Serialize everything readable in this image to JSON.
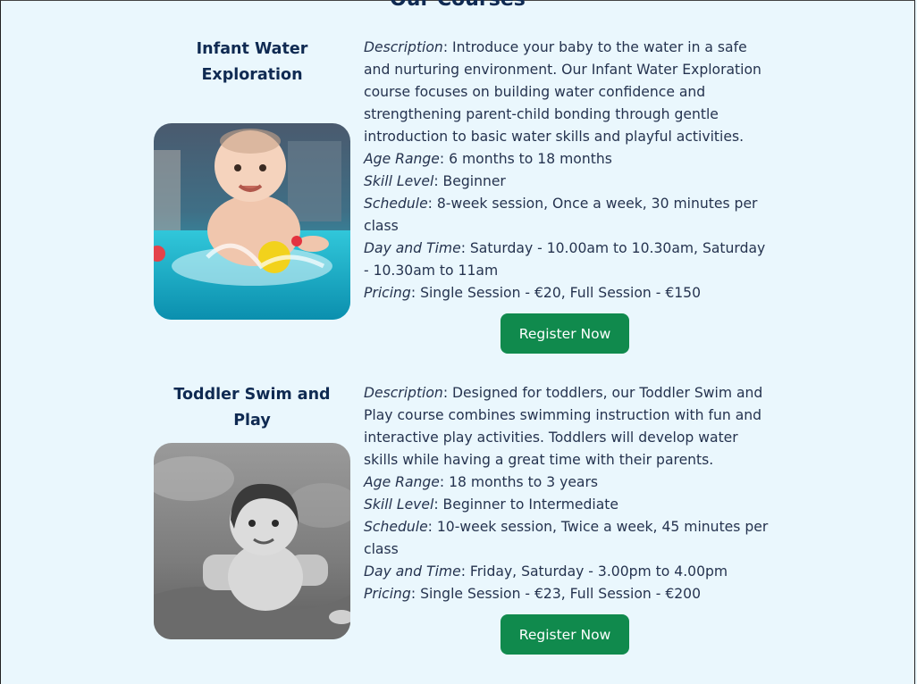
{
  "section": {
    "title": "Our Courses"
  },
  "courses": [
    {
      "title": "Infant Water Exploration",
      "description_label": "Description",
      "description": "Introduce your baby to the water in a safe and nurturing environment. Our Infant Water Exploration course focuses on building water confidence and strengthening parent-child bonding through gentle introduction to basic water skills and playful activities.",
      "age_label": "Age Range",
      "age": "6 months to 18 months",
      "skill_label": "Skill Level",
      "skill": "Beginner",
      "schedule_label": "Schedule",
      "schedule": "8-week session, Once a week, 30 minutes per class",
      "day_label": "Day and Time",
      "day": "Saturday - 10.00am to 10.30am, Saturday - 10.30am to 11am",
      "pricing_label": "Pricing",
      "pricing": "Single Session - €20, Full Session - €150",
      "register_label": "Register Now"
    },
    {
      "title": "Toddler Swim and Play",
      "description_label": "Description",
      "description": "Designed for toddlers, our Toddler Swim and Play course combines swimming instruction with fun and interactive play activities. Toddlers will develop water skills while having a great time with their parents.",
      "age_label": "Age Range",
      "age": "18 months to 3 years",
      "skill_label": "Skill Level",
      "skill": "Beginner to Intermediate",
      "schedule_label": "Schedule",
      "schedule": "10-week session, Twice a week, 45 minutes per class",
      "day_label": "Day and Time",
      "day": "Friday, Saturday - 3.00pm to 4.00pm",
      "pricing_label": "Pricing",
      "pricing": "Single Session - €23, Full Session - €200",
      "register_label": "Register Now"
    }
  ],
  "colors": {
    "background": "#eaf7fd",
    "heading": "#0f2a52",
    "button": "#108a4d"
  }
}
